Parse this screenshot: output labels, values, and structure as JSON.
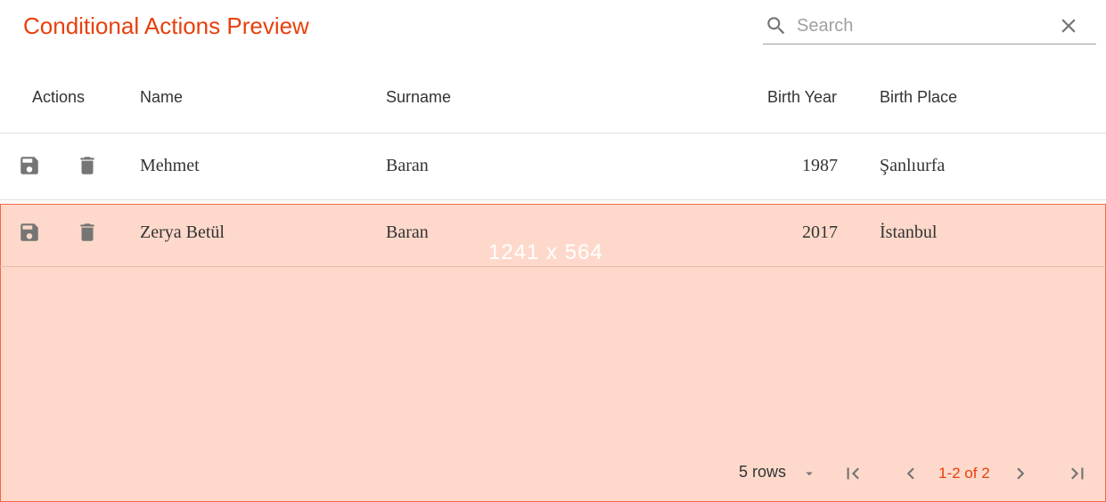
{
  "title": "Conditional Actions Preview",
  "search": {
    "placeholder": "Search",
    "value": ""
  },
  "columns": [
    "Actions",
    "Name",
    "Surname",
    "Birth Year",
    "Birth Place"
  ],
  "rows": [
    {
      "name": "Mehmet",
      "surname": "Baran",
      "birth_year": "1987",
      "birth_place": "Şanlıurfa"
    },
    {
      "name": "Zerya Betül",
      "surname": "Baran",
      "birth_year": "2017",
      "birth_place": "İstanbul"
    }
  ],
  "overlay_text": "1241 x 564",
  "pagination": {
    "rows_per_page": "5 rows",
    "page_info": "1-2 of 2"
  },
  "colors": {
    "accent": "#e8400c",
    "overlay": "#fdd8cb",
    "icon": "#757575"
  }
}
